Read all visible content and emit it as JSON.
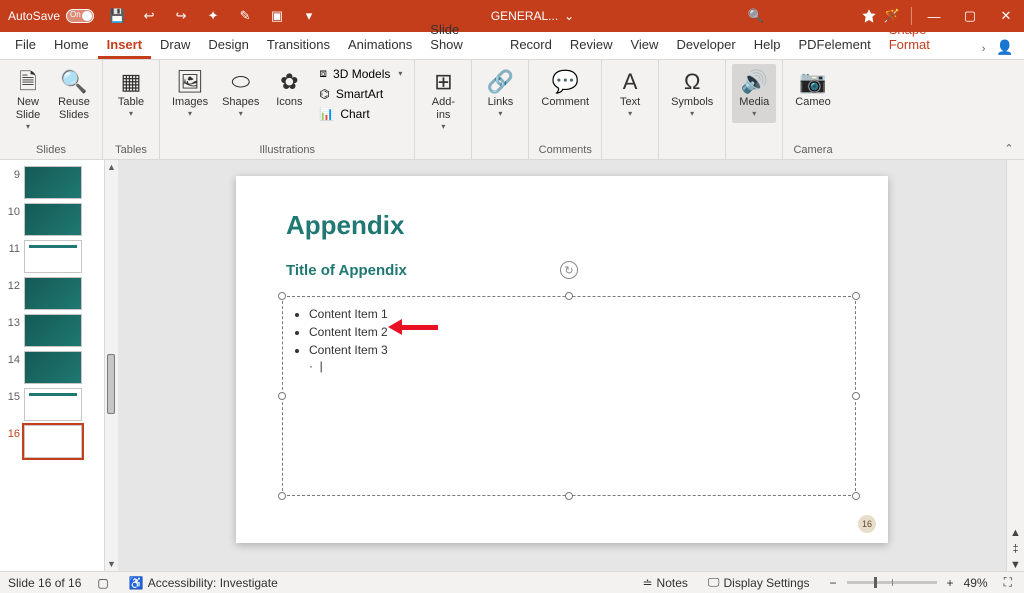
{
  "titlebar": {
    "autosave_label": "AutoSave",
    "autosave_state": "On",
    "doc_name": "GENERAL...",
    "doc_caret": "⌄"
  },
  "tabs": {
    "file": "File",
    "home": "Home",
    "insert": "Insert",
    "draw": "Draw",
    "design": "Design",
    "transitions": "Transitions",
    "animations": "Animations",
    "slideshow": "Slide Show",
    "record": "Record",
    "review": "Review",
    "view": "View",
    "developer": "Developer",
    "help": "Help",
    "pdfelement": "PDFelement",
    "shape_format": "Shape Format"
  },
  "ribbon": {
    "slides": {
      "group": "Slides",
      "new_slide": "New\nSlide",
      "reuse_slides": "Reuse\nSlides"
    },
    "tables": {
      "group": "Tables",
      "table": "Table"
    },
    "illustrations": {
      "group": "Illustrations",
      "images": "Images",
      "shapes": "Shapes",
      "icons": "Icons",
      "models": "3D Models",
      "smartart": "SmartArt",
      "chart": "Chart"
    },
    "addins": {
      "group": " ",
      "addins": "Add-\nins"
    },
    "links": {
      "links": "Links"
    },
    "comments": {
      "group": "Comments",
      "comment": "Comment"
    },
    "text": {
      "text": "Text"
    },
    "symbols": {
      "symbols": "Symbols"
    },
    "media": {
      "media": "Media"
    },
    "camera": {
      "group": "Camera",
      "cameo": "Cameo"
    }
  },
  "thumbs": {
    "items": [
      {
        "num": "9"
      },
      {
        "num": "10"
      },
      {
        "num": "11"
      },
      {
        "num": "12"
      },
      {
        "num": "13"
      },
      {
        "num": "14"
      },
      {
        "num": "15"
      },
      {
        "num": "16"
      }
    ]
  },
  "slide": {
    "title": "Appendix",
    "subtitle": "Title of Appendix",
    "bullets": [
      "Content Item 1",
      "Content Item 2",
      "Content Item 3"
    ],
    "cursor": "|",
    "badge": "16"
  },
  "status": {
    "slide_pos": "Slide 16 of 16",
    "accessibility": "Accessibility: Investigate",
    "notes": "Notes",
    "display": "Display Settings",
    "zoom": "49%"
  }
}
